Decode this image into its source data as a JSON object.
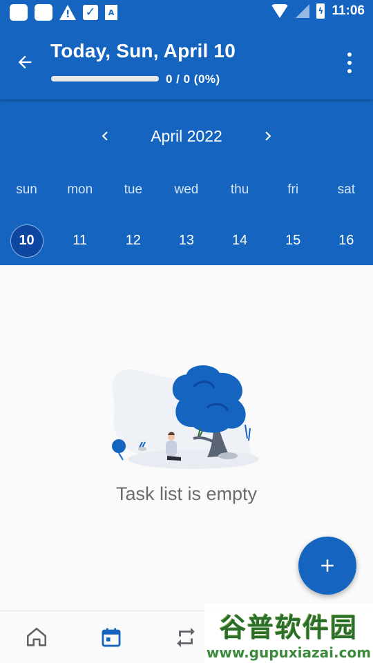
{
  "status_bar": {
    "time": "11:06",
    "icons": [
      "notification-square-icon",
      "notification-square-icon",
      "warning-icon",
      "checkbox-icon",
      "app-a-icon",
      "wifi-icon",
      "signal-off-icon",
      "battery-charging-icon"
    ]
  },
  "app_bar": {
    "title": "Today, Sun, April 10",
    "progress_text": "0 / 0 (0%)",
    "progress_fraction": 0,
    "back_icon": "arrow-back-icon",
    "menu_icon": "more-vert-icon"
  },
  "calendar": {
    "month_label": "April 2022",
    "weekdays": [
      "sun",
      "mon",
      "tue",
      "wed",
      "thu",
      "fri",
      "sat"
    ],
    "dates": [
      "10",
      "11",
      "12",
      "13",
      "14",
      "15",
      "16"
    ],
    "selected_index": 0
  },
  "empty_state": {
    "message": "Task list is empty"
  },
  "fab": {
    "icon": "add-icon"
  },
  "bottom_nav": {
    "items": [
      {
        "icon": "home-icon",
        "active": false
      },
      {
        "icon": "calendar-icon",
        "active": true
      },
      {
        "icon": "repeat-icon",
        "active": false
      }
    ]
  },
  "watermark": {
    "title": "谷普软件园",
    "url": "www.gupuxiazai.com"
  },
  "colors": {
    "primary": "#1565c0",
    "primary_dark": "#0d47a1",
    "background": "#fafafa",
    "text_muted": "#6b6b6b"
  }
}
